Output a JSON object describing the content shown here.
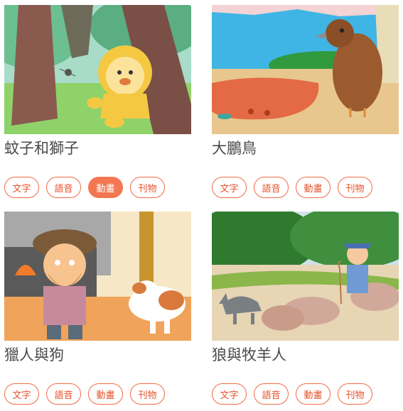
{
  "stories": [
    {
      "title": "蚊子和獅子",
      "image": "mosquito-and-lion-illustration",
      "tags": [
        {
          "label": "文字",
          "active": false
        },
        {
          "label": "語音",
          "active": false
        },
        {
          "label": "動畫",
          "active": true
        },
        {
          "label": "刊物",
          "active": false
        }
      ]
    },
    {
      "title": "大鵬鳥",
      "image": "roc-bird-illustration",
      "tags": [
        {
          "label": "文字",
          "active": false
        },
        {
          "label": "語音",
          "active": false
        },
        {
          "label": "動畫",
          "active": false
        },
        {
          "label": "刊物",
          "active": false
        }
      ]
    },
    {
      "title": "獵人與狗",
      "image": "hunter-and-dog-illustration",
      "tags": [
        {
          "label": "文字",
          "active": false
        },
        {
          "label": "語音",
          "active": false
        },
        {
          "label": "動畫",
          "active": false
        },
        {
          "label": "刊物",
          "active": false
        }
      ]
    },
    {
      "title": "狼與牧羊人",
      "image": "wolf-and-shepherd-illustration",
      "tags": [
        {
          "label": "文字",
          "active": false
        },
        {
          "label": "語音",
          "active": false
        },
        {
          "label": "動畫",
          "active": false
        },
        {
          "label": "刊物",
          "active": false
        }
      ]
    }
  ],
  "colors": {
    "accent": "#f37752",
    "title": "#4a4a4a"
  }
}
